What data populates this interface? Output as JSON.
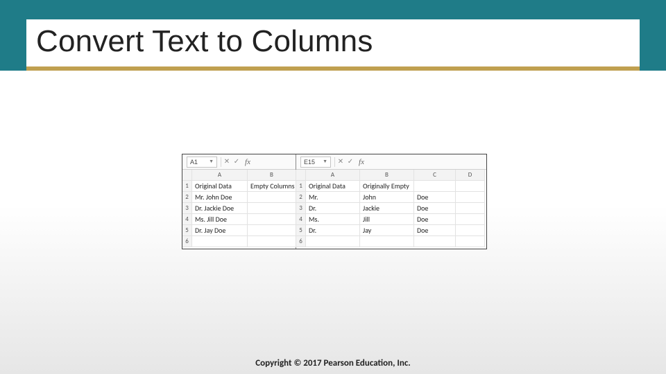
{
  "slide": {
    "title": "Convert Text to Columns",
    "copyright": "Copyright © 2017 Pearson Education, Inc."
  },
  "panes": {
    "left": {
      "nameBox": "A1",
      "fx": "fx",
      "columns": [
        "A",
        "B"
      ],
      "rows": [
        {
          "n": "1",
          "cells": [
            "Original Data",
            "Empty Columns"
          ]
        },
        {
          "n": "2",
          "cells": [
            "Mr. John Doe",
            ""
          ]
        },
        {
          "n": "3",
          "cells": [
            "Dr. Jackie Doe",
            ""
          ]
        },
        {
          "n": "4",
          "cells": [
            "Ms. Jill Doe",
            ""
          ]
        },
        {
          "n": "5",
          "cells": [
            "Dr. Jay Doe",
            ""
          ]
        },
        {
          "n": "6",
          "cells": [
            "",
            ""
          ]
        }
      ]
    },
    "right": {
      "nameBox": "E15",
      "fx": "fx",
      "columns": [
        "A",
        "B",
        "C",
        "D"
      ],
      "rows": [
        {
          "n": "1",
          "cells": [
            "Original Data",
            "Originally Empty",
            "",
            ""
          ]
        },
        {
          "n": "2",
          "cells": [
            "Mr.",
            "John",
            "Doe",
            ""
          ]
        },
        {
          "n": "3",
          "cells": [
            "Dr.",
            "Jackie",
            "Doe",
            ""
          ]
        },
        {
          "n": "4",
          "cells": [
            "Ms.",
            "Jill",
            "Doe",
            ""
          ]
        },
        {
          "n": "5",
          "cells": [
            "Dr.",
            "Jay",
            "Doe",
            ""
          ]
        },
        {
          "n": "6",
          "cells": [
            "",
            "",
            "",
            ""
          ]
        }
      ]
    }
  }
}
